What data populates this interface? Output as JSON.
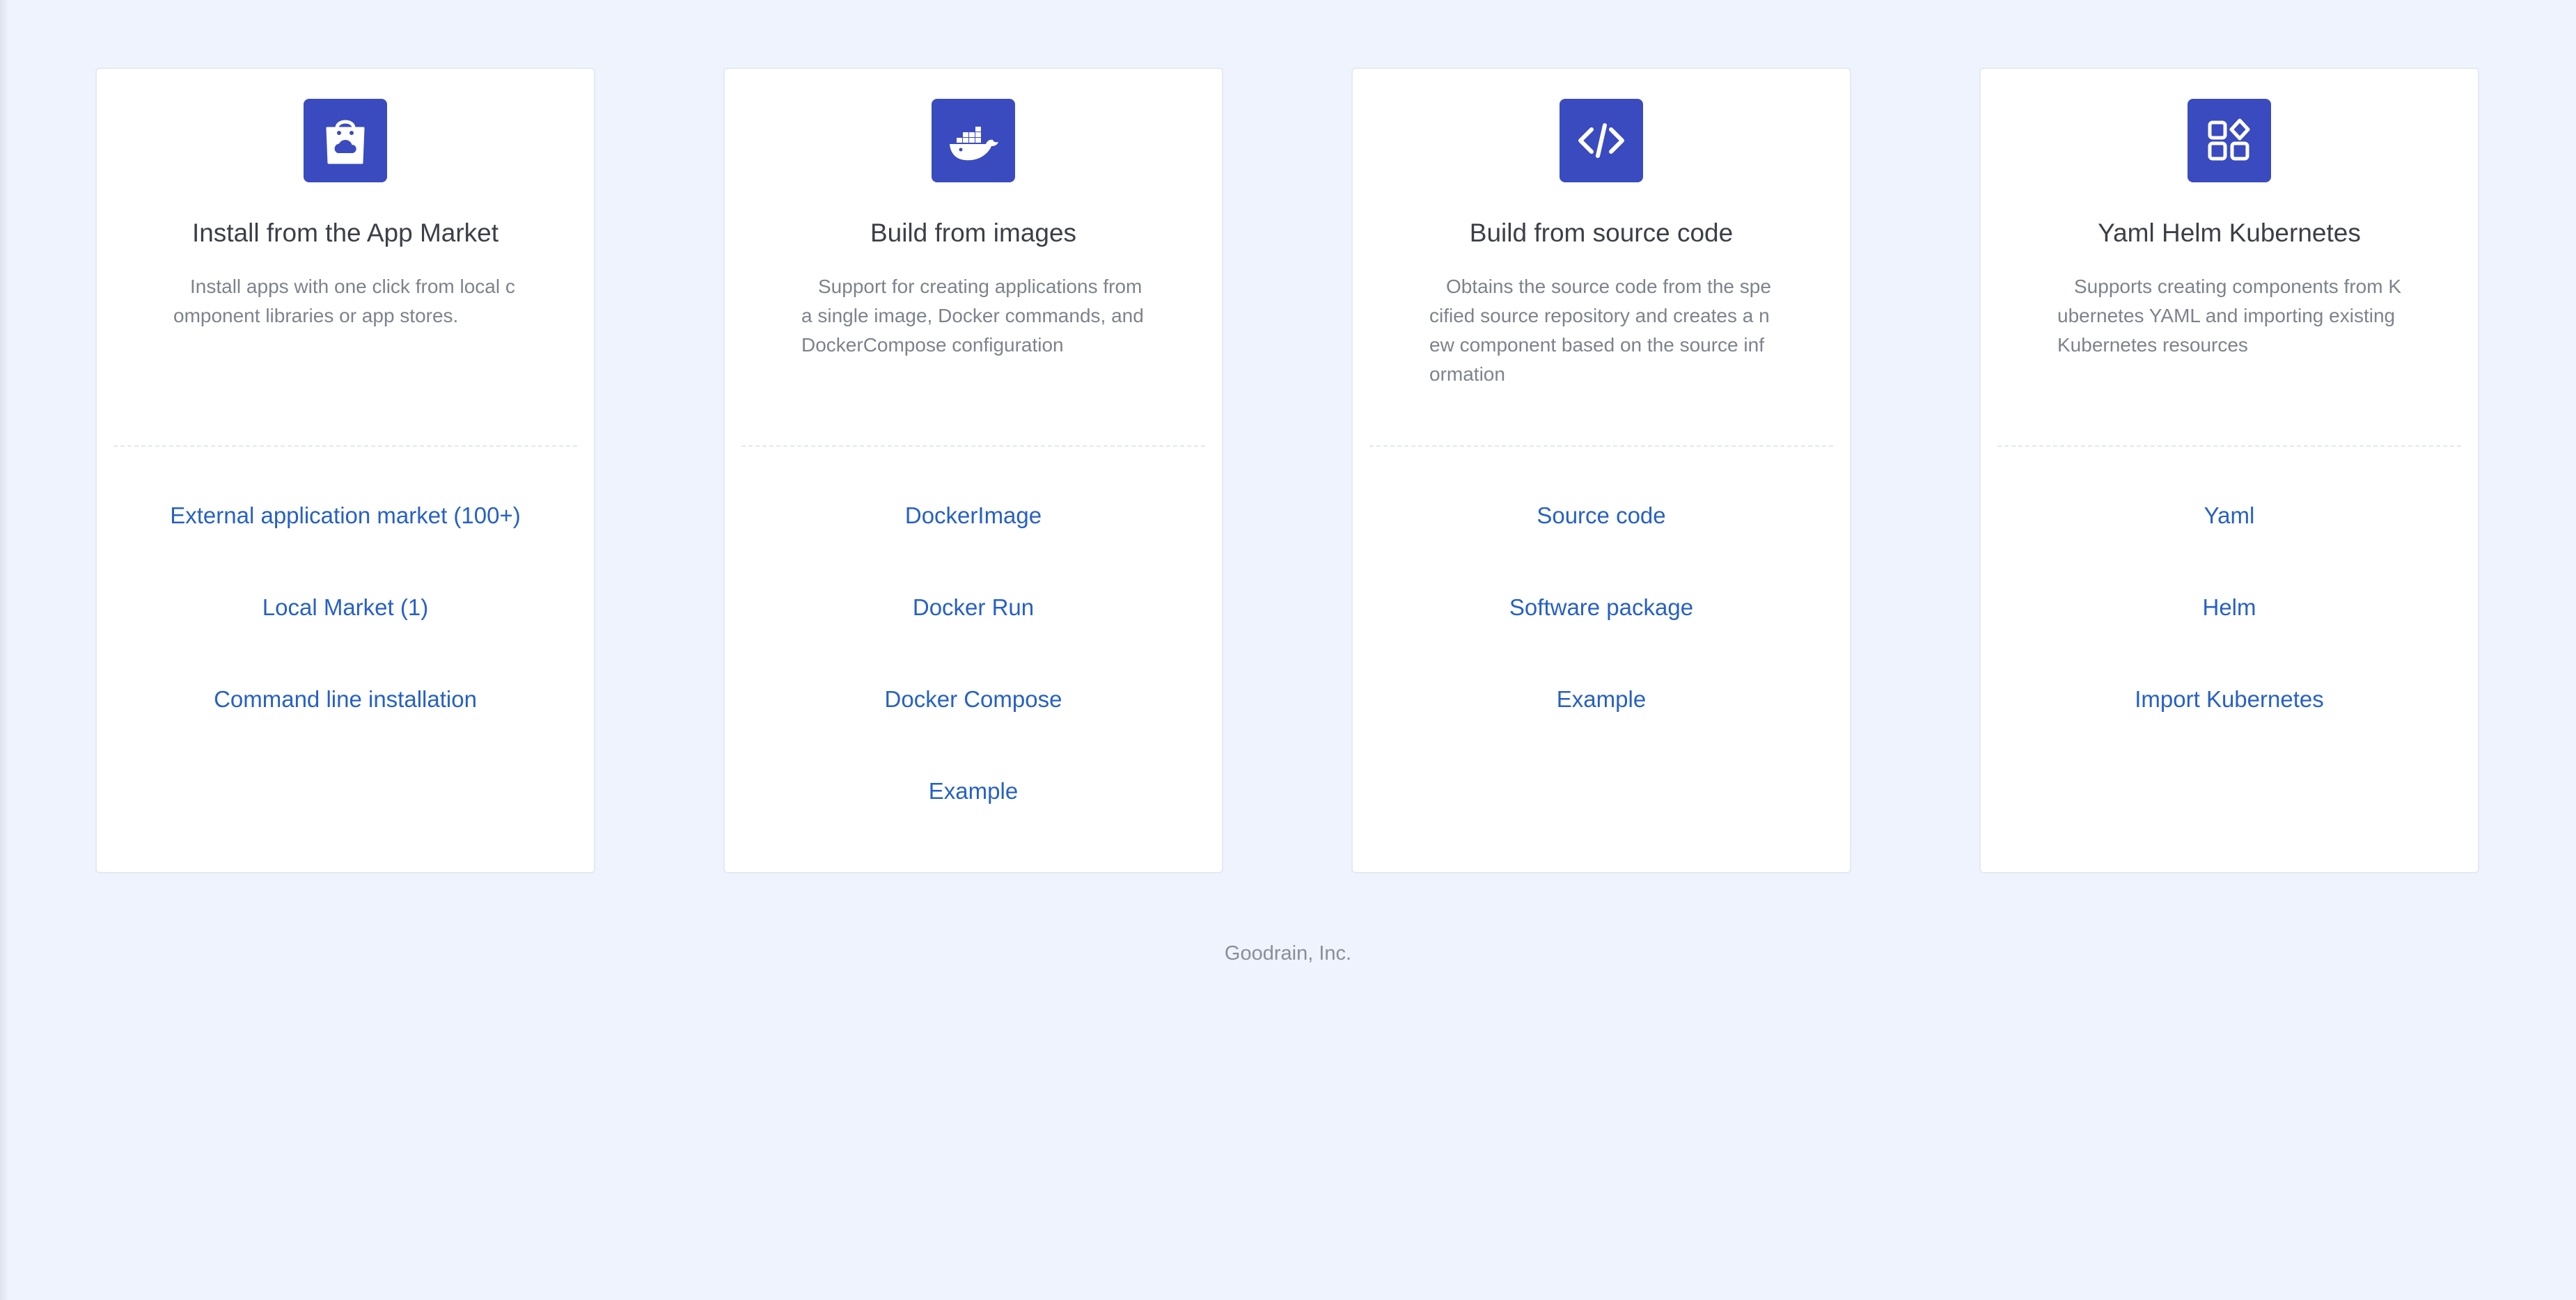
{
  "cards": [
    {
      "icon": "shopping-bag-cloud-icon",
      "title": "Install from the App Market",
      "description": "Install apps with one click from local component libraries or app stores.",
      "links": [
        "External application market (100+)",
        "Local Market (1)",
        "Command line installation"
      ]
    },
    {
      "icon": "docker-whale-icon",
      "title": "Build from images",
      "description": "Support for creating applications from a single image, Docker commands, and DockerCompose configuration",
      "links": [
        "DockerImage",
        "Docker Run",
        "Docker Compose",
        "Example"
      ]
    },
    {
      "icon": "code-brackets-icon",
      "title": "Build from source code",
      "description": "Obtains the source code from the specified source repository and creates a new component based on the source information",
      "links": [
        "Source code",
        "Software package",
        "Example"
      ]
    },
    {
      "icon": "app-grid-icon",
      "title": "Yaml Helm Kubernetes",
      "description": "Supports creating components from Kubernetes YAML and importing existing Kubernetes resources",
      "links": [
        "Yaml",
        "Helm",
        "Import Kubernetes"
      ]
    }
  ],
  "footer": {
    "text": "Goodrain, Inc."
  },
  "colors": {
    "background": "#eef3fd",
    "icon_background": "#3a4bbf",
    "link": "#2760c6",
    "title": "#3c3f47",
    "description": "#7e828c"
  }
}
